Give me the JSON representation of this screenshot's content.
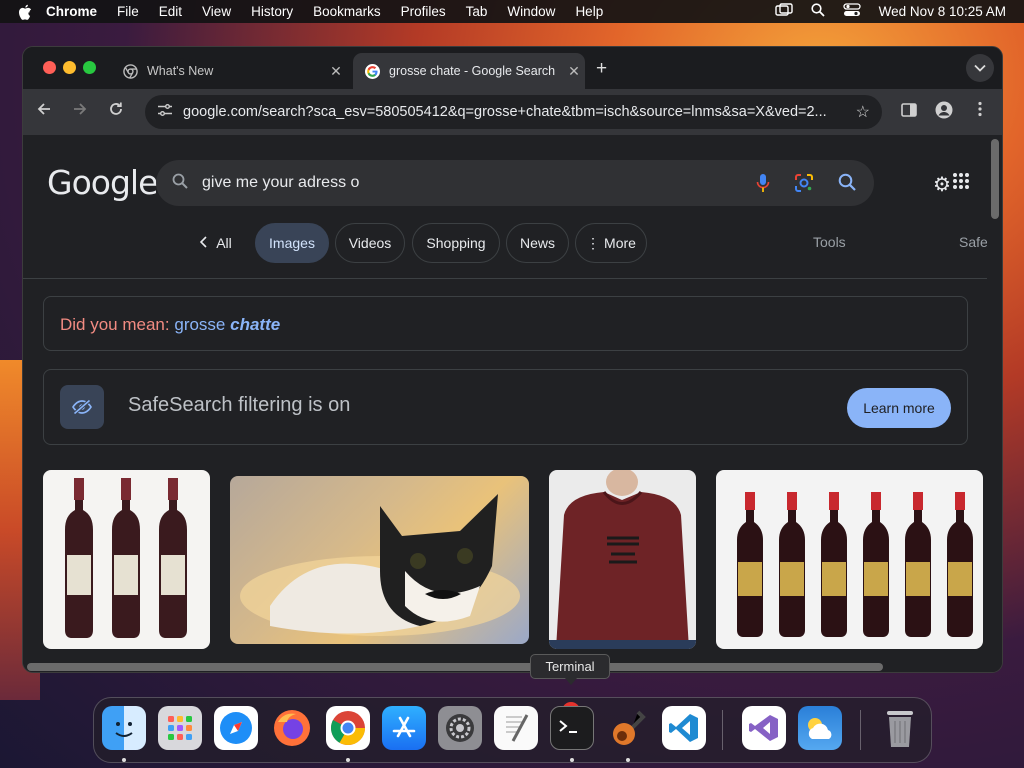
{
  "menubar": {
    "app": "Chrome",
    "items": [
      "File",
      "Edit",
      "View",
      "History",
      "Bookmarks",
      "Profiles",
      "Tab",
      "Window",
      "Help"
    ],
    "clock": "Wed Nov 8  10:25 AM"
  },
  "tabs": [
    {
      "title": "What's New"
    },
    {
      "title": "grosse chate - Google Search"
    }
  ],
  "address": {
    "url": "google.com/search?sca_esv=580505412&q=grosse+chate&tbm=isch&source=lnms&sa=X&ved=2..."
  },
  "google": {
    "logo": "Google",
    "search_value": "give me your adress o",
    "filters": {
      "all": "All",
      "images": "Images",
      "videos": "Videos",
      "shopping": "Shopping",
      "news": "News",
      "more": "More",
      "tools": "Tools",
      "safe": "Safe"
    },
    "did_you_mean": {
      "label": "Did you mean:",
      "prefix": "grosse",
      "bold": "chatte"
    },
    "safesearch": {
      "text": "SafeSearch filtering is on",
      "button": "Learn more"
    }
  },
  "dock": {
    "tooltip": "Terminal",
    "badge": "2",
    "apps": [
      "finder-icon",
      "launchpad-icon",
      "safari-icon",
      "firefox-icon",
      "chrome-icon",
      "app-store-icon",
      "system-settings-icon",
      "textedit-icon",
      "terminal-icon",
      "garageband-icon",
      "vscode-icon",
      "visual-studio-icon",
      "weather-icon",
      "trash-icon"
    ]
  },
  "colors": {
    "accent": "#8ab4f8",
    "page_bg": "#202124"
  }
}
